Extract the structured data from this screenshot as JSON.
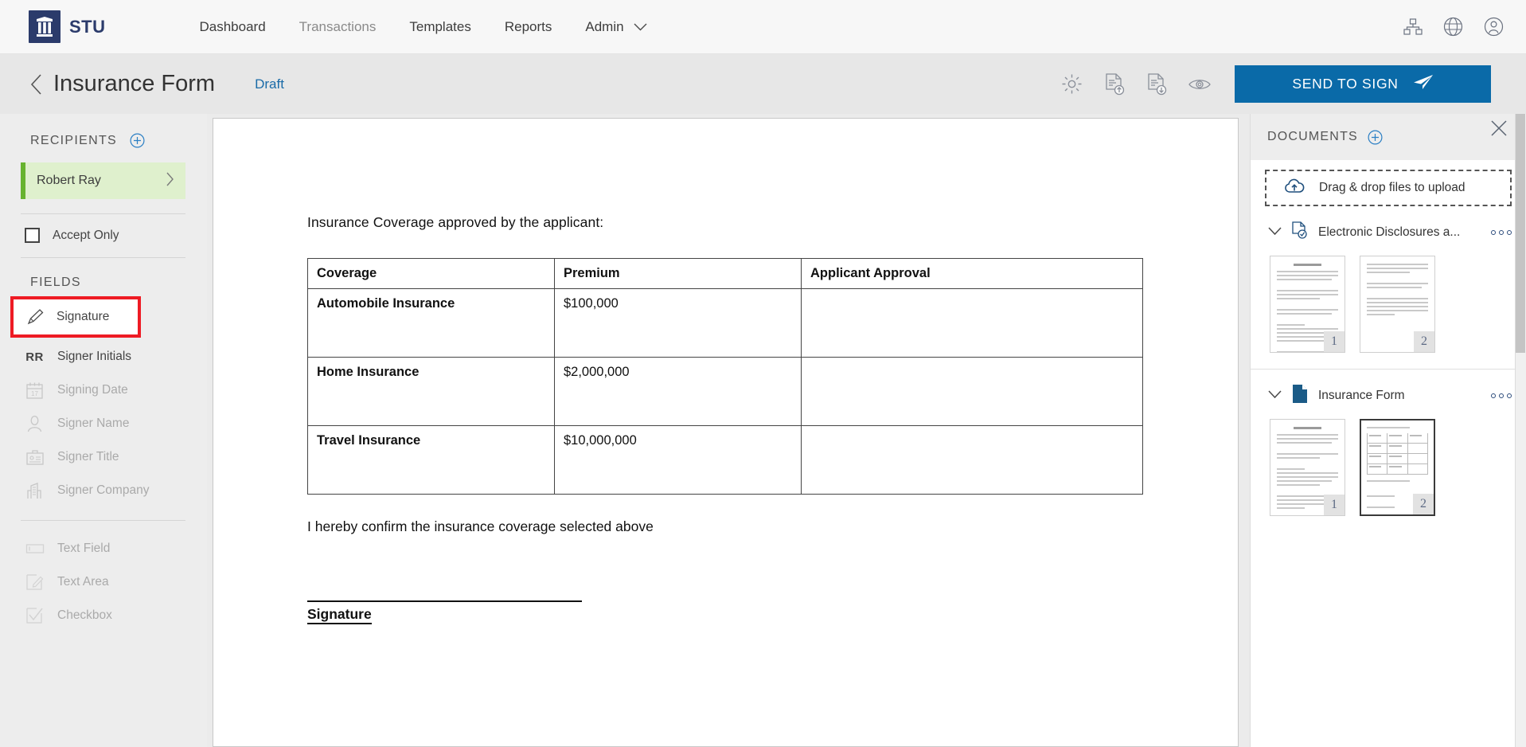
{
  "topnav": {
    "brand": "STU",
    "logo_icon": "pillar-icon",
    "links": [
      {
        "label": "Dashboard",
        "muted": false
      },
      {
        "label": "Transactions",
        "muted": true
      },
      {
        "label": "Templates",
        "muted": false
      },
      {
        "label": "Reports",
        "muted": false
      },
      {
        "label": "Admin",
        "muted": false,
        "caret": true
      }
    ],
    "icons": [
      "sitemap-icon",
      "globe-icon",
      "user-account-icon"
    ]
  },
  "subheader": {
    "back_icon": "chevron-left-icon",
    "title": "Insurance Form",
    "status": "Draft",
    "tools": [
      "gear-icon",
      "document-upload-icon",
      "document-download-icon",
      "eye-preview-icon"
    ],
    "send_button": "SEND TO SIGN",
    "send_icon": "paper-plane-icon",
    "accent": "#0a6aa8"
  },
  "sidebar": {
    "recipients_label": "RECIPIENTS",
    "add_recipient_icon": "plus-circle-icon",
    "recipient": {
      "name": "Robert Ray",
      "chevron": "chevron-right-icon",
      "highlight": "#dff0cd",
      "bar": "#67b32e"
    },
    "accept_only": {
      "label": "Accept Only",
      "checked": false
    },
    "fields_label": "FIELDS",
    "fields": [
      {
        "label": "Signature",
        "icon": "pen-icon",
        "disabled": false,
        "highlighted": true
      },
      {
        "label": "Signer Initials",
        "icon": "RR",
        "disabled": false,
        "highlighted": false
      },
      {
        "label": "Signing Date",
        "icon": "calendar-icon",
        "icon_text": "17",
        "disabled": true,
        "highlighted": false
      },
      {
        "label": "Signer Name",
        "icon": "person-icon",
        "disabled": true,
        "highlighted": false
      },
      {
        "label": "Signer Title",
        "icon": "id-badge-icon",
        "disabled": true,
        "highlighted": false
      },
      {
        "label": "Signer Company",
        "icon": "building-icon",
        "disabled": true,
        "highlighted": false
      }
    ],
    "fields_group2": [
      {
        "label": "Text Field",
        "icon": "text-field-icon",
        "disabled": true
      },
      {
        "label": "Text Area",
        "icon": "text-area-icon",
        "disabled": true
      },
      {
        "label": "Checkbox",
        "icon": "checkbox-icon",
        "disabled": true
      }
    ],
    "highlight_color": "#ee1b24"
  },
  "document": {
    "lead": "Insurance Coverage approved by the applicant:",
    "table": {
      "headers": [
        "Coverage",
        "Premium",
        "Applicant Approval"
      ],
      "rows": [
        {
          "coverage": "Automobile Insurance",
          "premium": "$100,000",
          "approval": ""
        },
        {
          "coverage": "Home Insurance",
          "premium": "$2,000,000",
          "approval": ""
        },
        {
          "coverage": "Travel Insurance",
          "premium": "$10,000,000",
          "approval": ""
        }
      ]
    },
    "confirm": "I hereby confirm the insurance coverage selected above",
    "signature_label": "Signature"
  },
  "rightpanel": {
    "title": "DOCUMENTS",
    "add_icon": "plus-circle-icon",
    "close_icon": "close-icon",
    "dropzone": {
      "label": "Drag & drop files to upload",
      "icon": "cloud-upload-icon"
    },
    "groups": [
      {
        "name": "Electronic Disclosures a...",
        "icon": "document-check-icon",
        "chevron": "chevron-down-icon",
        "menu_icon": "three-dots-icon",
        "pages": [
          {
            "number": "1",
            "selected": false,
            "kind": "text"
          },
          {
            "number": "2",
            "selected": false,
            "kind": "text-short"
          }
        ]
      },
      {
        "name": "Insurance Form",
        "icon": "document-filled-icon",
        "chevron": "chevron-down-icon",
        "menu_icon": "three-dots-icon",
        "pages": [
          {
            "number": "1",
            "selected": false,
            "kind": "text"
          },
          {
            "number": "2",
            "selected": true,
            "kind": "table"
          }
        ]
      }
    ]
  }
}
